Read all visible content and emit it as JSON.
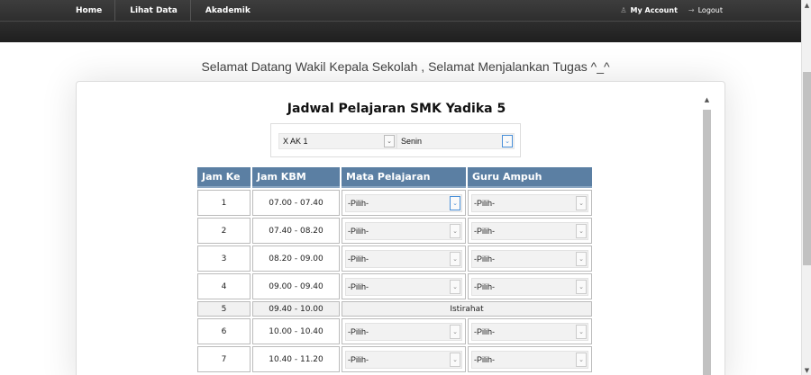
{
  "nav": {
    "items": [
      "Home",
      "Lihat Data",
      "Akademik"
    ],
    "account": "My Account",
    "logout": "Logout"
  },
  "welcome": "Selamat Datang Wakil Kepala Sekolah , Selamat Menjalankan Tugas ^_^",
  "title": "Jadwal Pelajaran SMK Yadika 5",
  "filters": {
    "kelas": "X AK 1",
    "hari": "Senin"
  },
  "table": {
    "headers": [
      "Jam Ke",
      "Jam KBM",
      "Mata Pelajaran",
      "Guru Ampuh"
    ],
    "select_placeholder": "-Pilih-",
    "rows": [
      {
        "no": "1",
        "jam": "07.00 - 07.40"
      },
      {
        "no": "2",
        "jam": "07.40 - 08.20"
      },
      {
        "no": "3",
        "jam": "08.20 - 09.00"
      },
      {
        "no": "4",
        "jam": "09.00 - 09.40"
      },
      {
        "no": "5",
        "jam": "09.40 - 10.00",
        "break": "Istirahat"
      },
      {
        "no": "6",
        "jam": "10.00 - 10.40"
      },
      {
        "no": "7",
        "jam": "10.40 - 11.20"
      }
    ]
  },
  "icons": {
    "account": "user-icon",
    "logout": "arrow-right-icon",
    "dropdown": "chevron-down-icon"
  },
  "colors": {
    "header_bg": "#5b7fa3",
    "nav_bg": "#2e2e2e",
    "focus": "#4a90d9"
  }
}
